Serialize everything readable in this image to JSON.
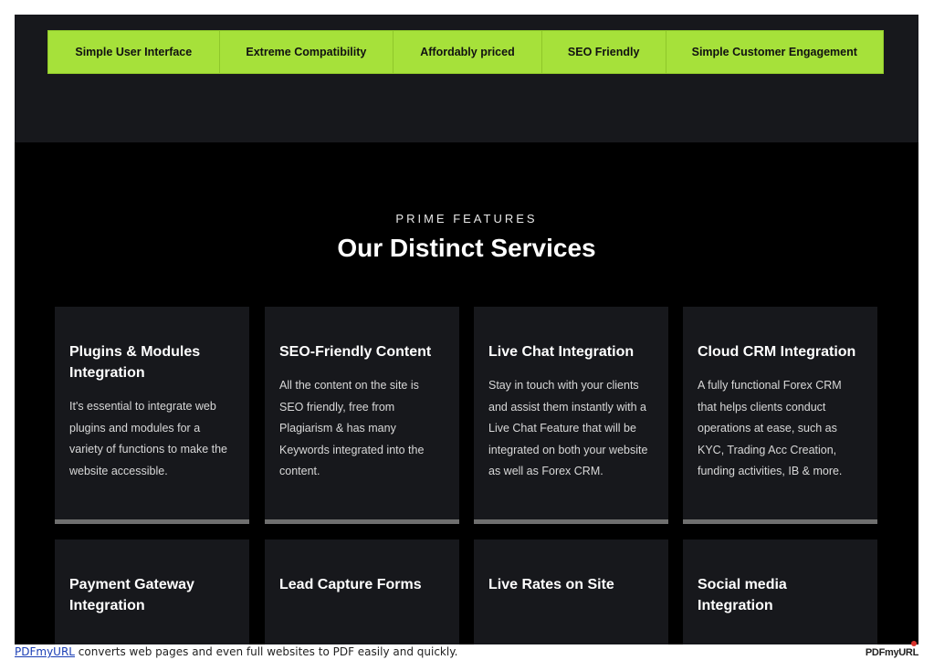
{
  "feature_bar": {
    "items": [
      {
        "label": "Simple User Interface"
      },
      {
        "label": "Extreme Compatibility"
      },
      {
        "label": "Affordably priced"
      },
      {
        "label": "SEO Friendly"
      },
      {
        "label": "Simple Customer Engagement"
      }
    ]
  },
  "section": {
    "eyebrow": "PRIME FEATURES",
    "title": "Our Distinct Services"
  },
  "services": [
    {
      "title": "Plugins & Modules Integration",
      "text": "It's essential to integrate web plugins and modules for a variety of functions to make the website accessible."
    },
    {
      "title": "SEO-Friendly Content",
      "text": "All the content on the site is SEO friendly, free from Plagiarism & has many Keywords integrated into the content."
    },
    {
      "title": "Live Chat Integration",
      "text": "Stay in touch with your clients and assist them instantly with a Live Chat Feature that will be integrated on both your website as well as Forex CRM."
    },
    {
      "title": "Cloud CRM Integration",
      "text": "A fully functional Forex CRM that helps clients conduct operations at ease, such as KYC, Trading Acc Creation, funding activities, IB & more."
    },
    {
      "title": "Payment Gateway Integration",
      "text": ""
    },
    {
      "title": "Lead Capture Forms",
      "text": ""
    },
    {
      "title": "Live Rates on Site",
      "text": ""
    },
    {
      "title": "Social media Integration",
      "text": ""
    }
  ],
  "footer": {
    "link": "PDFmyURL",
    "text": " converts web pages and even full websites to PDF easily and quickly.",
    "logo": "PDFmyURL"
  },
  "colors": {
    "accent": "#a6e13a",
    "card_bg": "#17181c",
    "page_bg": "#000000"
  }
}
